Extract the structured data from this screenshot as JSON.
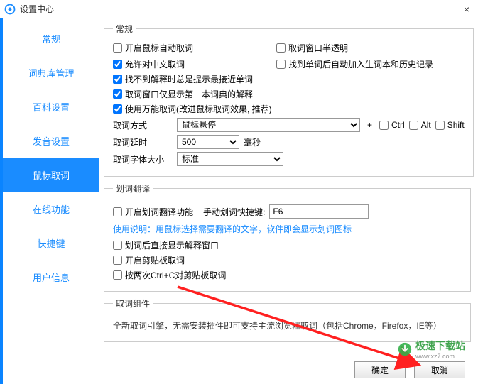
{
  "window": {
    "title": "设置中心"
  },
  "sidebar": {
    "items": [
      {
        "label": "常规"
      },
      {
        "label": "词典库管理"
      },
      {
        "label": "百科设置"
      },
      {
        "label": "发音设置"
      },
      {
        "label": "鼠标取词"
      },
      {
        "label": "在线功能"
      },
      {
        "label": "快捷键"
      },
      {
        "label": "用户信息"
      }
    ],
    "selected_index": 4
  },
  "group_general": {
    "title": "常规",
    "options": {
      "enable_mouse_capture": "开启鼠标自动取词",
      "window_translucent": "取词窗口半透明",
      "allow_chinese": "允许对中文取词",
      "auto_add_wordbook": "找到单词后自动加入生词本和历史记录",
      "suggest_nearest": "找不到解释时总是提示最接近单词",
      "first_dict_only": "取词窗口仅显示第一本词典的解释",
      "use_universal": "使用万能取词(改进鼠标取词效果, 推荐)"
    },
    "method_label": "取词方式",
    "method_selected": "鼠标悬停",
    "plus": "+",
    "mod_ctrl": "Ctrl",
    "mod_alt": "Alt",
    "mod_shift": "Shift",
    "delay_label": "取词延时",
    "delay_value": "500",
    "delay_unit": "毫秒",
    "font_label": "取词字体大小",
    "font_selected": "标准"
  },
  "group_translate": {
    "title": "划词翻译",
    "enable": "开启划词翻译功能",
    "hotkey_label": "手动划词快捷键:",
    "hotkey_value": "F6",
    "help": "使用说明：用鼠标选择需要翻译的文字，软件即会显示划词图标",
    "show_window": "划词后直接显示解释窗口",
    "clipboard": "开启剪贴板取词",
    "double_ctrlc": "按两次Ctrl+C对剪贴板取词"
  },
  "group_component": {
    "title": "取词组件",
    "text": "全新取词引擎，无需安装插件即可支持主流浏览器取词（包括Chrome，Firefox，IE等）"
  },
  "buttons": {
    "ok": "确定",
    "cancel": "取消"
  },
  "watermark": {
    "name": "极速下载站",
    "url": "www.xz7.com"
  }
}
